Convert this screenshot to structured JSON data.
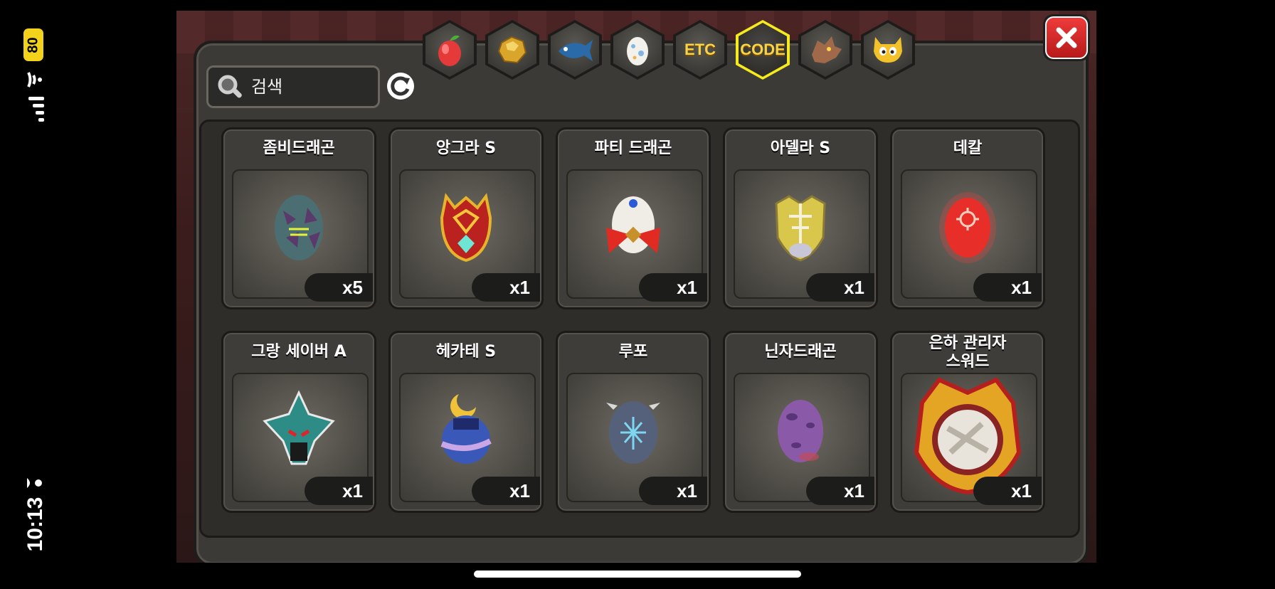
{
  "status": {
    "battery": "80",
    "time": "10:13"
  },
  "search": {
    "placeholder": "검색"
  },
  "tabs": [
    {
      "id": "fruit",
      "icon": "fruit-icon",
      "label": ""
    },
    {
      "id": "gold",
      "icon": "gold-nugget-icon",
      "label": ""
    },
    {
      "id": "fish",
      "icon": "fish-icon",
      "label": ""
    },
    {
      "id": "egg",
      "icon": "egg-icon",
      "label": ""
    },
    {
      "id": "etc",
      "icon": "",
      "label": "ETC"
    },
    {
      "id": "code",
      "icon": "",
      "label": "CODE",
      "active": true
    },
    {
      "id": "dragon",
      "icon": "dragon-head-icon",
      "label": ""
    },
    {
      "id": "monster",
      "icon": "yellow-monster-icon",
      "label": ""
    }
  ],
  "items": [
    {
      "name": "좀비드래곤",
      "qty": "x5",
      "icon": "zombie-dragon-egg-icon",
      "color": "#4b6e72"
    },
    {
      "name": "앙그라 S",
      "qty": "x1",
      "icon": "angra-egg-icon",
      "color": "#b9221e"
    },
    {
      "name": "파티 드래곤",
      "qty": "x1",
      "icon": "party-dragon-egg-icon",
      "color": "#f0ece6"
    },
    {
      "name": "아델라 S",
      "qty": "x1",
      "icon": "adela-egg-icon",
      "color": "#d8c74a"
    },
    {
      "name": "데칼",
      "qty": "x1",
      "icon": "decal-egg-icon",
      "color": "#e02a22"
    },
    {
      "name": "그랑 세이버 A",
      "qty": "x1",
      "icon": "grand-saber-egg-icon",
      "color": "#2d8c86"
    },
    {
      "name": "헤카테 S",
      "qty": "x1",
      "icon": "hecate-egg-icon",
      "color": "#3a58b8"
    },
    {
      "name": "루포",
      "qty": "x1",
      "icon": "lupo-egg-icon",
      "color": "#55607a"
    },
    {
      "name": "닌자드래곤",
      "qty": "x1",
      "icon": "ninja-dragon-egg-icon",
      "color": "#8a5aa8"
    },
    {
      "name": "은하 관리자\n스워드",
      "qty": "x1",
      "icon": "galaxy-sword-egg-icon",
      "color": "#e5a524"
    }
  ]
}
